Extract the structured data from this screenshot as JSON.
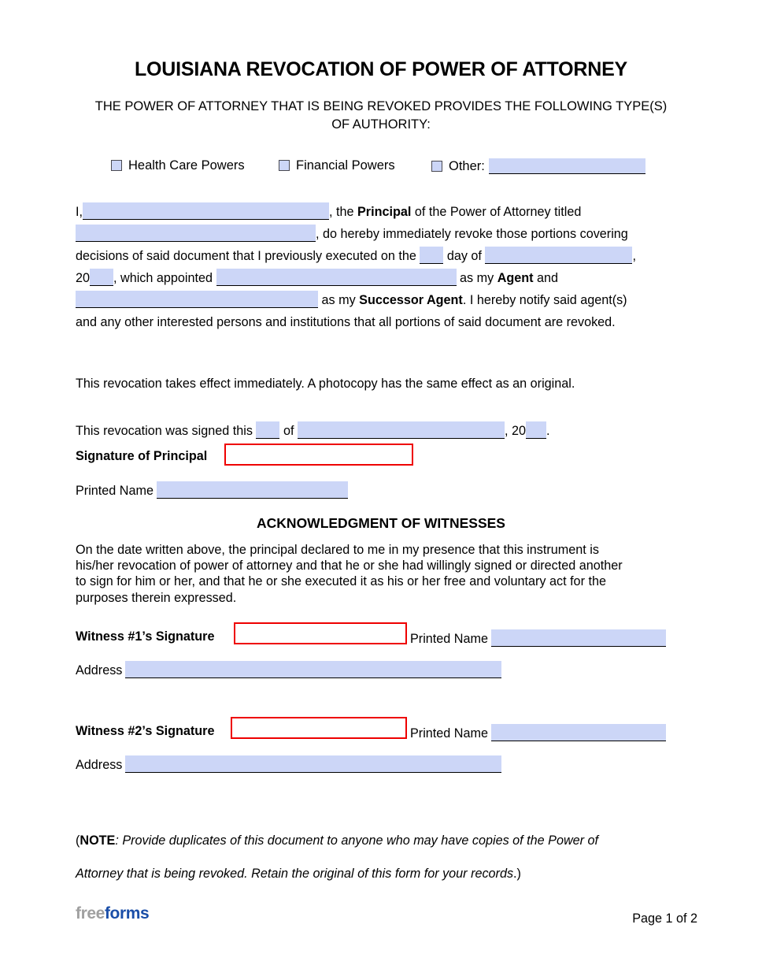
{
  "document": {
    "title": "LOUISIANA REVOCATION OF POWER OF ATTORNEY",
    "subtitle": "THE POWER OF ATTORNEY THAT IS BEING REVOKED PROVIDES THE FOLLOWING TYPE(S) OF AUTHORITY:"
  },
  "colors": {
    "field_fill": "#ccd6f7",
    "signature_box_border": "#ee0000",
    "logo_gray": "#a0a0a0",
    "logo_blue": "#1a4ea8"
  },
  "authority_types": {
    "options": [
      {
        "label": "Health Care Powers",
        "checked": false
      },
      {
        "label": "Financial Powers",
        "checked": false
      },
      {
        "label": "Other:",
        "checked": false,
        "value": ""
      }
    ]
  },
  "revocation_paragraph": {
    "line1_prefix": "I,",
    "principal_name_value": "",
    "line1_mid": ", the ",
    "principal_bold": "Principal",
    "line1_suffix": " of the Power of Attorney titled",
    "poa_title_value": "",
    "line2_suffix": ", do hereby immediately revoke those portions covering",
    "line3_prefix": "decisions of said document that I previously executed on the",
    "day_value": "",
    "line3_mid": "day of",
    "month_value": "",
    "line3_comma": ",",
    "year_prefix": "20",
    "year_value": "",
    "line4_mid": ", which appointed",
    "agent_value": "",
    "line4_asmy": "as my ",
    "agent_bold": "Agent",
    "line4_and": " and",
    "successor_value": "",
    "line5_asmy": "as my ",
    "successor_bold": "Successor Agent",
    "line5_suffix": ". I hereby notify said agent(s)",
    "line6": "and any other interested persons and institutions that all portions of said document are revoked."
  },
  "effect_statement": "This revocation takes effect immediately. A photocopy has the same effect as an original.",
  "signing": {
    "prefix": "This revocation was signed this",
    "day_value": "",
    "of": "of",
    "month_value": "",
    "comma": ",",
    "year_prefix": "20",
    "year_value": "",
    "period": ".",
    "signature_label": "Signature of Principal",
    "signature_value": "",
    "printed_name_label": "Printed Name",
    "printed_name_value": ""
  },
  "acknowledgment": {
    "heading": "ACKNOWLEDGMENT OF WITNESSES",
    "body": "On the date written above, the principal declared to me in my presence that this instrument is his/her revocation of power of attorney and that he or she had willingly signed or directed another to sign for him or her, and that he or she executed it as his or her free and voluntary act for the purposes therein expressed."
  },
  "witnesses": [
    {
      "signature_label": "Witness #1’s Signature",
      "signature_value": "",
      "printed_name_label": "Printed Name",
      "printed_name_value": "",
      "address_label": "Address",
      "address_value": ""
    },
    {
      "signature_label": "Witness #2’s Signature",
      "signature_value": "",
      "printed_name_label": "Printed Name",
      "printed_name_value": "",
      "address_label": "Address",
      "address_value": ""
    }
  ],
  "note": {
    "open_paren": "(",
    "bold_prefix": "NOTE",
    "line1": ": Provide duplicates of this document to anyone who may have copies of the Power of",
    "line2": "Attorney that is being revoked. Retain the original of this form for your records",
    "close_paren": ".)"
  },
  "footer": {
    "logo_first": "free",
    "logo_second": "forms",
    "page_indicator": "Page 1 of 2"
  }
}
